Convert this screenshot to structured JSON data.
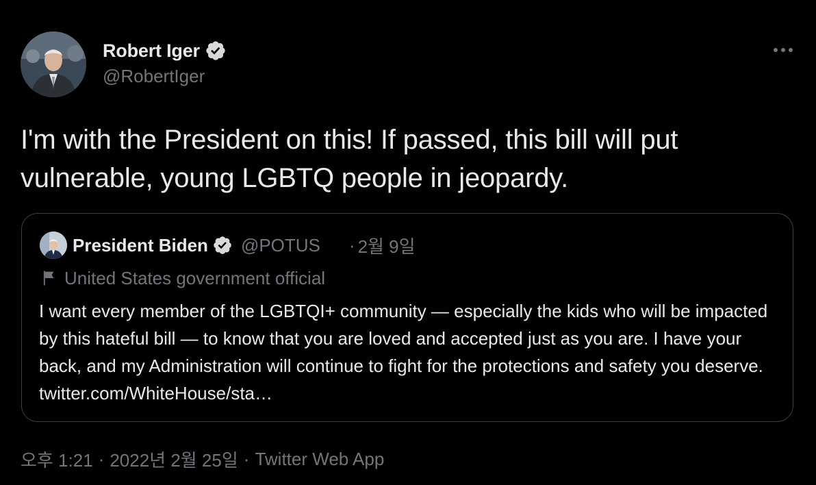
{
  "author": {
    "name": "Robert Iger",
    "handle": "@RobertIger",
    "verified": true,
    "avatar_icon": "profile-photo"
  },
  "more_icon": "more-horizontal-icon",
  "more_label": "···",
  "tweet": {
    "text": "I'm with the President on this! If passed, this bill will put vulnerable, young LGBTQ people in jeopardy."
  },
  "quote": {
    "name": "President Biden",
    "handle": "@POTUS",
    "separator": "·",
    "date": "2월 9일",
    "label": "United States government official",
    "label_icon": "flag-icon",
    "text": "I want every member of the LGBTQI+ community — especially the kids who will be impacted by this hateful bill — to know that you are loved and accepted just as you are. I have your back, and my Administration will continue to fight for the protections and safety you deserve. twitter.com/WhiteHouse/sta…"
  },
  "meta": {
    "time": "오후 1:21",
    "separator": "·",
    "date": "2022년 2월 25일",
    "source": "Twitter Web App"
  },
  "colors": {
    "background": "#000000",
    "text_primary": "#e7e9ea",
    "text_secondary": "#71767b",
    "border": "#3a3f44",
    "verified_badge": "#d9d9d9"
  }
}
